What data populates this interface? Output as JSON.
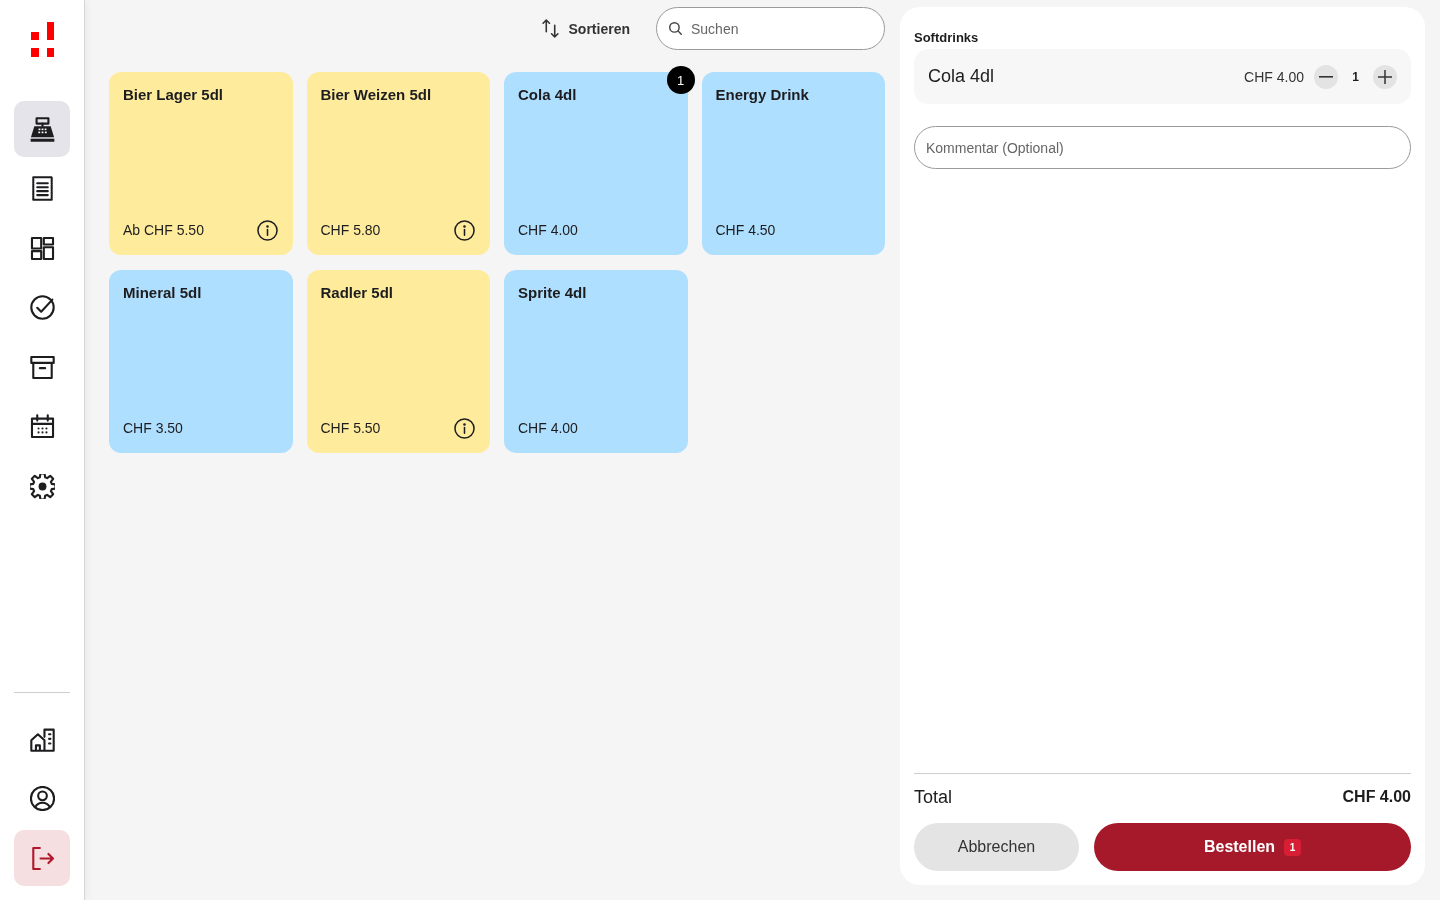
{
  "sidebar": {
    "nav_items": [
      {
        "selected": true
      },
      {
        "selected": false
      },
      {
        "selected": false
      },
      {
        "selected": false
      },
      {
        "selected": false
      },
      {
        "selected": false
      },
      {
        "selected": false
      }
    ],
    "bottom_items": [
      {
        "kind": "default"
      },
      {
        "kind": "default"
      },
      {
        "kind": "danger"
      }
    ]
  },
  "toolbar": {
    "sort_label": "Sortieren",
    "search": {
      "placeholder": "Suchen"
    }
  },
  "products": [
    {
      "name": "Bier Lager 5dl",
      "price": "Ab CHF 5.50",
      "color": "#feec9c",
      "info": true
    },
    {
      "name": "Bier Weizen 5dl",
      "price": "CHF 5.80",
      "color": "#feec9c",
      "info": true
    },
    {
      "name": "Cola 4dl",
      "price": "CHF 4.00",
      "color": "#afdfff",
      "info": false,
      "badge": "1"
    },
    {
      "name": "Energy Drink",
      "price": "CHF 4.50",
      "color": "#afdfff",
      "info": false
    },
    {
      "name": "Mineral 5dl",
      "price": "CHF 3.50",
      "color": "#afdfff",
      "info": false
    },
    {
      "name": "Radler 5dl",
      "price": "CHF 5.50",
      "color": "#feec9c",
      "info": true
    },
    {
      "name": "Sprite 4dl",
      "price": "CHF 4.00",
      "color": "#afdfff",
      "info": false
    }
  ],
  "order": {
    "category": "Softdrinks",
    "items": [
      {
        "name": "Cola 4dl",
        "price": "CHF 4.00",
        "quantity": "1"
      }
    ],
    "comment": {
      "placeholder": "Kommentar (Optional)"
    },
    "total": {
      "label": "Total",
      "value": "CHF 4.00"
    },
    "actions": [
      {
        "kind": "secondary",
        "label": "Abbrechen"
      },
      {
        "kind": "primary",
        "label": "Bestellen",
        "badge": "1"
      }
    ]
  }
}
